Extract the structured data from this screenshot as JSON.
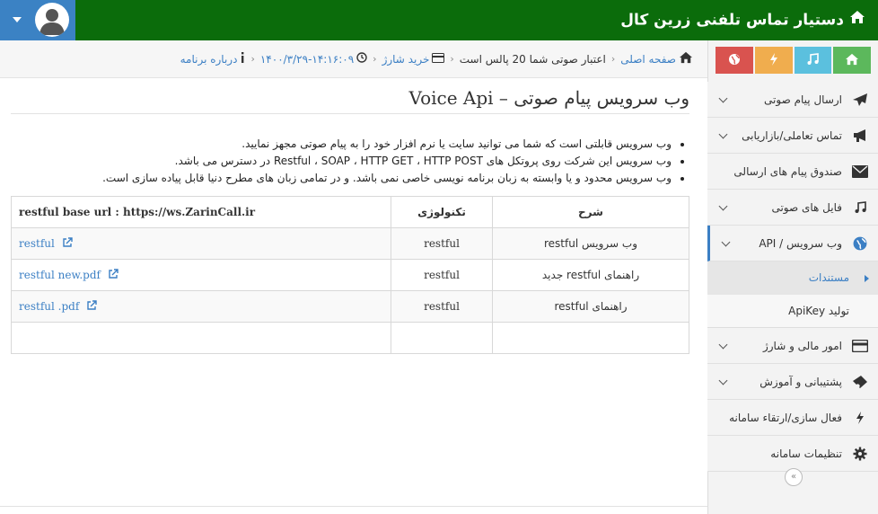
{
  "app": {
    "title": "دستیار تماس تلفنی زرین کال",
    "colors": {
      "topbar": "#0b6c0b",
      "user_box": "#3b82c4",
      "link": "#3b7fc4"
    }
  },
  "quick_buttons": [
    {
      "icon": "home-icon",
      "color": "#5cb85c"
    },
    {
      "icon": "music-icon",
      "color": "#5bc0de"
    },
    {
      "icon": "bolt-icon",
      "color": "#f0ad4e"
    },
    {
      "icon": "globe-icon",
      "color": "#d9534f"
    }
  ],
  "sidebar": {
    "items": [
      {
        "label": "ارسال پیام صوتی",
        "icon": "paper-plane-icon"
      },
      {
        "label": "تماس تعاملی/بازاریابی",
        "icon": "megaphone-icon"
      },
      {
        "label": "صندوق پیام های ارسالی",
        "icon": "envelope-icon"
      },
      {
        "label": "فایل های صوتی",
        "icon": "music-icon"
      },
      {
        "label": "وب سرویس / API",
        "icon": "globe-icon"
      },
      {
        "label": "امور مالی و شارژ",
        "icon": "credit-card-icon"
      },
      {
        "label": "پشتیبانی و آموزش",
        "icon": "ticket-icon"
      },
      {
        "label": "فعال سازی/ارتقاء سامانه",
        "icon": "bolt-icon"
      },
      {
        "label": "تنظیمات سامانه",
        "icon": "gear-icon"
      }
    ],
    "sub_items": [
      {
        "label": "مستندات"
      },
      {
        "label": "تولید ApiKey"
      }
    ],
    "collapse_glyph": "«"
  },
  "breadcrumb": {
    "home": "صفحه اصلی",
    "credit": "اعتبار صوتی شما 20 پالس است",
    "buy": "خرید شارژ",
    "datetime": "۱۴۰۰/۳/۲۹-۱۴:۱۶:۰۹",
    "about": "درباره برنامه"
  },
  "main": {
    "title": "وب سرویس پیام صوتی – Voice Api",
    "bullets": [
      "وب سرویس قابلتی است که شما می توانید سایت یا نرم افزار خود را به پیام صوتی مجهز نمایید.",
      "وب سرویس این شرکت روی پروتکل های Restful ، SOAP ، HTTP GET ، HTTP POST در دسترس می باشد.",
      "وب سرویس محدود و یا وابسته به زبان برنامه نویسی خاصی نمی باشد. و در تمامی زبان های مطرح دنیا قابل پیاده سازی است."
    ],
    "table": {
      "headers": [
        "شرح",
        "تکنولوژی",
        "restful base url : https://ws.ZarinCall.ir"
      ],
      "rows": [
        {
          "desc": "وب سرویس restful",
          "tech": "restful",
          "link": "restful"
        },
        {
          "desc": "راهنمای restful جدید",
          "tech": "restful",
          "link": "restful new.pdf"
        },
        {
          "desc": "راهنمای restful",
          "tech": "restful",
          "link": "restful .pdf"
        },
        {
          "desc": "",
          "tech": "",
          "link": ""
        }
      ]
    }
  }
}
